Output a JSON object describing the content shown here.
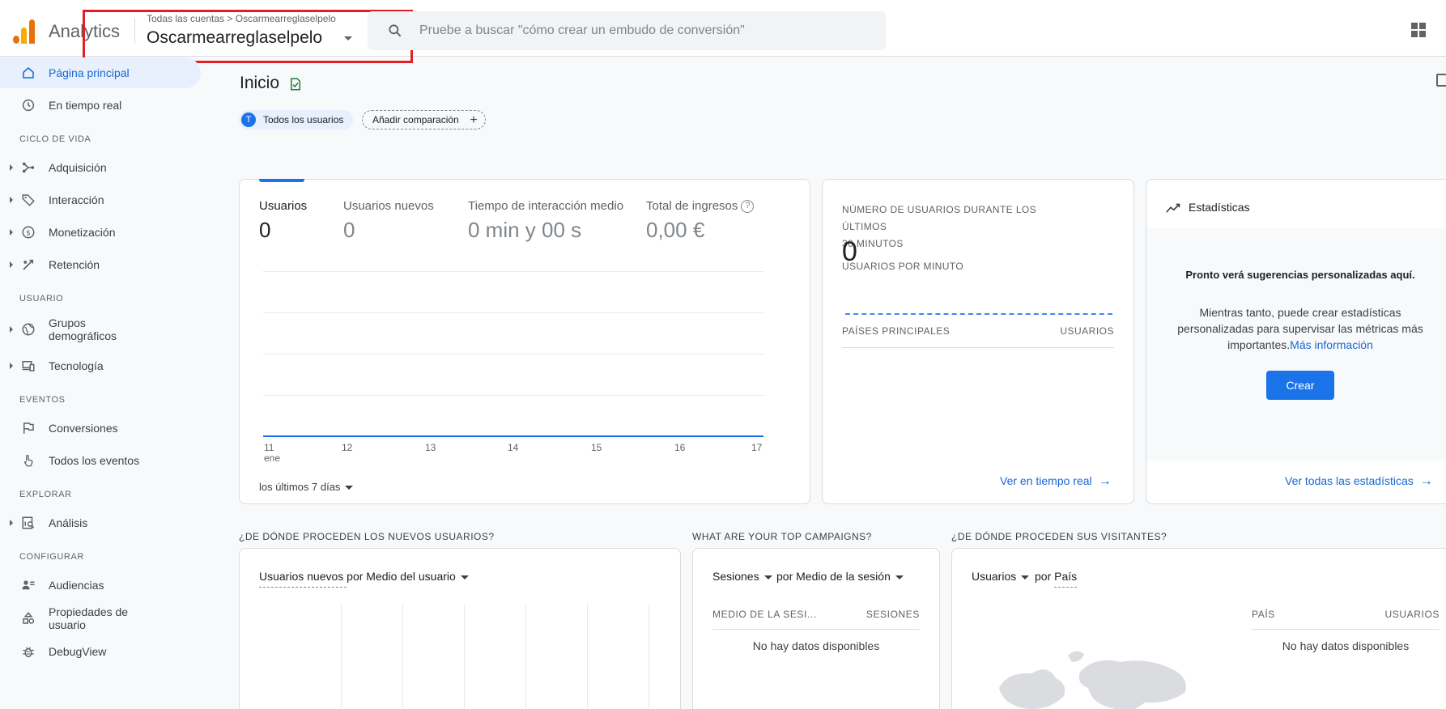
{
  "header": {
    "app_name": "Analytics",
    "breadcrumb": "Todas las cuentas > Oscarmearreglaselpelo",
    "property": "Oscarmearreglaselpelo",
    "search_placeholder": "Pruebe a buscar \"cómo crear un embudo de conversión\""
  },
  "sidebar": {
    "top_items": [
      {
        "label": "Página principal",
        "icon": "home-icon",
        "active": true
      },
      {
        "label": "En tiempo real",
        "icon": "clock-icon"
      }
    ],
    "sections": [
      {
        "title": "CICLO DE VIDA",
        "items": [
          {
            "label": "Adquisición",
            "icon": "acquisition-icon"
          },
          {
            "label": "Interacción",
            "icon": "tag-icon"
          },
          {
            "label": "Monetización",
            "icon": "dollar-icon"
          },
          {
            "label": "Retención",
            "icon": "retention-icon"
          }
        ]
      },
      {
        "title": "USUARIO",
        "items": [
          {
            "label": "Grupos demográficos",
            "line1": "Grupos",
            "line2": "demográficos",
            "icon": "globe-icon"
          },
          {
            "label": "Tecnología",
            "icon": "devices-icon"
          }
        ]
      },
      {
        "title": "EVENTOS",
        "items": [
          {
            "label": "Conversiones",
            "icon": "flag-icon"
          },
          {
            "label": "Todos los eventos",
            "icon": "touch-icon"
          }
        ]
      },
      {
        "title": "EXPLORAR",
        "items": [
          {
            "label": "Análisis",
            "icon": "analysis-icon"
          }
        ]
      },
      {
        "title": "CONFIGURAR",
        "items": [
          {
            "label": "Audiencias",
            "icon": "audience-icon"
          },
          {
            "label": "Propiedades de usuario",
            "line1": "Propiedades de",
            "line2": "usuario",
            "icon": "properties-icon"
          },
          {
            "label": "DebugView",
            "icon": "bug-icon"
          }
        ]
      }
    ]
  },
  "main": {
    "title": "Inicio",
    "chip_users_initial": "T",
    "chip_users": "Todos los usuarios",
    "chip_add": "Añadir comparación",
    "add_symbol": "+",
    "overview": {
      "metrics": [
        {
          "label": "Usuarios",
          "value": "0"
        },
        {
          "label": "Usuarios nuevos",
          "value": "0"
        },
        {
          "label": "Tiempo de interacción medio",
          "value": "0 min y 00 s"
        },
        {
          "label": "Total de ingresos",
          "value": "0,00 €"
        }
      ],
      "help_symbol": "?",
      "x_ticks": [
        "11",
        "12",
        "13",
        "14",
        "15",
        "16",
        "17"
      ],
      "x_first_sub": "ene",
      "date_range": "los últimos 7 días"
    },
    "realtime": {
      "title": "NÚMERO DE USUARIOS DURANTE LOS ÚLTIMOS 30 MINUTOS",
      "title_line1": "NÚMERO DE USUARIOS DURANTE LOS ÚLTIMOS",
      "title_line2": "30 MINUTOS",
      "value": "0",
      "subtitle": "USUARIOS POR MINUTO",
      "col_left": "PAÍSES PRINCIPALES",
      "col_right": "USUARIOS",
      "link": "Ver en tiempo real"
    },
    "insights": {
      "title": "Estadísticas",
      "bold": "Pronto verá sugerencias personalizadas aquí.",
      "text": "Mientras tanto, puede crear estadísticas personalizadas para supervisar las métricas más importantes.",
      "more_link": "Más información",
      "button": "Crear",
      "link": "Ver todas las estadísticas"
    },
    "sections": {
      "new_users_title": "¿DE DÓNDE PROCEDEN LOS NUEVOS USUARIOS?",
      "new_users_selector": "Usuarios nuevos por Medio del usuario",
      "campaigns_title": "WHAT ARE YOUR TOP CAMPAIGNS?",
      "campaigns_metric": "Sesiones",
      "campaigns_dim": "por Medio de la sesión",
      "campaigns_col_left": "MEDIO DE LA SESI...",
      "campaigns_col_right": "SESIONES",
      "campaigns_empty": "No hay datos disponibles",
      "visitors_title": "¿DE DÓNDE PROCEDEN SUS VISITANTES?",
      "visitors_metric": "Usuarios",
      "visitors_dim": "por País",
      "visitors_col_left": "PAÍS",
      "visitors_col_right": "USUARIOS",
      "visitors_empty": "No hay datos disponibles"
    }
  },
  "colors": {
    "accent": "#1a73e8",
    "highlight_box": "#e31e24",
    "logo_orange": "#e8710a",
    "logo_yellow": "#f9ab00"
  }
}
